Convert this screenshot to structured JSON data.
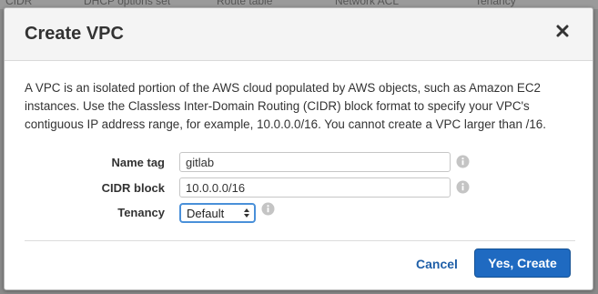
{
  "background_tabs": [
    "CIDR",
    "DHCP options set",
    "Route table",
    "Network ACL",
    "Tenancy"
  ],
  "modal": {
    "title": "Create VPC",
    "close_icon": "close-icon",
    "description": "A VPC is an isolated portion of the AWS cloud populated by AWS objects, such as Amazon EC2 instances. Use the Classless Inter-Domain Routing (CIDR) block format to specify your VPC's contiguous IP address range, for example, 10.0.0.0/16. You cannot create a VPC larger than /16."
  },
  "form": {
    "name_tag": {
      "label": "Name tag",
      "value": "gitlab",
      "info_icon": "info-icon"
    },
    "cidr_block": {
      "label": "CIDR block",
      "value": "10.0.0.0/16",
      "info_icon": "info-icon"
    },
    "tenancy": {
      "label": "Tenancy",
      "selected": "Default",
      "info_icon": "info-icon"
    }
  },
  "footer": {
    "cancel_label": "Cancel",
    "create_label": "Yes, Create"
  },
  "colors": {
    "primary_button": "#1f6ac1",
    "link": "#1f5fa8",
    "focus_ring": "#4a90d9"
  }
}
